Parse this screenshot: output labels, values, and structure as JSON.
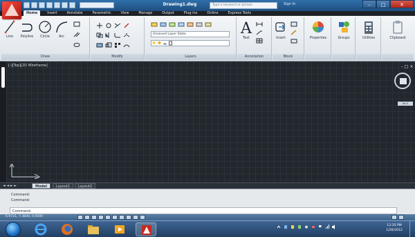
{
  "titlebar": {
    "document_title": "Drawing1.dwg",
    "search_placeholder": "Type a keyword or phrase",
    "signin_label": "Sign In",
    "minimize": "–",
    "maximize": "□",
    "close": "✕"
  },
  "ribbon_tabs": [
    "Home",
    "Insert",
    "Annotate",
    "Parametric",
    "View",
    "Manage",
    "Output",
    "Plug-ins",
    "Online",
    "Express Tools"
  ],
  "draw_panel": {
    "title": "Draw",
    "tools": [
      "Line",
      "Polyline",
      "Circle",
      "Arc"
    ]
  },
  "modify_panel": {
    "title": "Modify"
  },
  "layers_panel": {
    "title": "Layers",
    "layer_state": "Unsaved Layer State",
    "current_layer": "0"
  },
  "annotation_panel": {
    "title": "Annotation",
    "text_label": "Text"
  },
  "block_panel": {
    "title": "Block",
    "insert_label": "Insert"
  },
  "right_tools": [
    "Properties",
    "Groups",
    "Utilities",
    "Clipboard"
  ],
  "viewport": {
    "label": "[-][Top][2D Wireframe]",
    "controls": "– □ ×",
    "viewcube_face": "TOP",
    "wcs_label": "WCS"
  },
  "layout_tabs": {
    "nav": "◄ ◄ ► ►",
    "tabs": [
      "Model",
      "Layout1",
      "Layout2"
    ]
  },
  "command": {
    "history": [
      "Command:",
      "Command:"
    ],
    "prompt": "Command:"
  },
  "status": {
    "coords": "6.9721, 7.3840, 0.0000"
  },
  "clock": {
    "time": "12:35 PM",
    "date": "1/26/2012"
  },
  "colors": {
    "title_blue": "#2f6fa9",
    "viewport_bg": "#22272d",
    "ribbon_bg": "#eef1f4",
    "autocad_red": "#d7352a"
  }
}
